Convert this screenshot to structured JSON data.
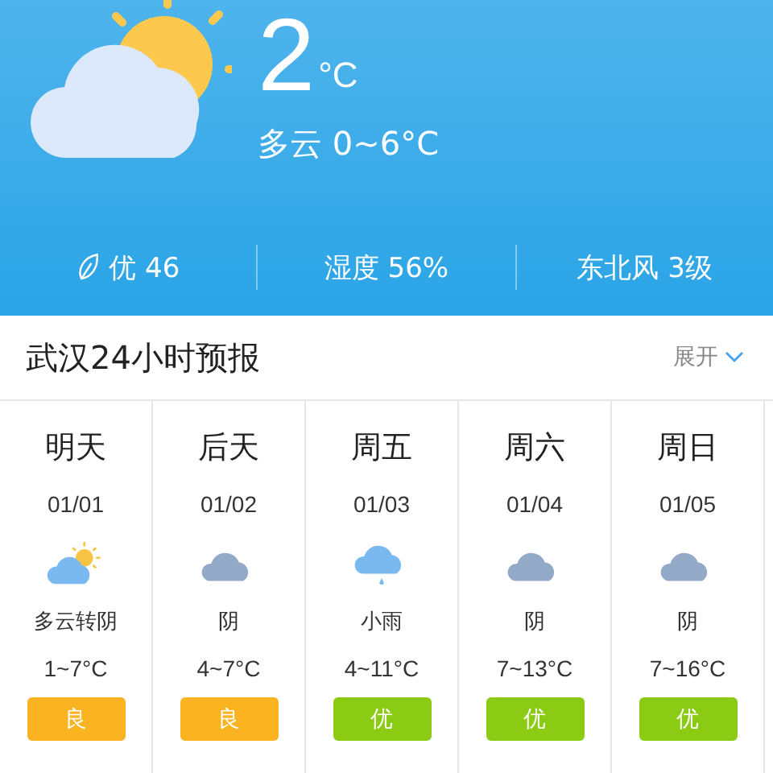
{
  "current": {
    "kind": "partly_cloudy",
    "temperature": "2",
    "unit": "°C",
    "summary": "多云 0~6°C"
  },
  "stats": [
    {
      "kind": "aqi",
      "text": "优 46"
    },
    {
      "kind": "plain",
      "text": "湿度 56%"
    },
    {
      "kind": "plain",
      "text": "东北风 3级"
    }
  ],
  "forecast": {
    "title": "武汉24小时预报",
    "expand_label": "展开",
    "days": [
      {
        "day": "明天",
        "date": "01/01",
        "kind": "partly_cloudy",
        "condition": "多云转阴",
        "temp": "1~7°C",
        "aqi": "良",
        "color": "#fbb321"
      },
      {
        "day": "后天",
        "date": "01/02",
        "kind": "overcast",
        "condition": "阴",
        "temp": "4~7°C",
        "aqi": "良",
        "color": "#fbb321"
      },
      {
        "day": "周五",
        "date": "01/03",
        "kind": "light_rain",
        "condition": "小雨",
        "temp": "4~11°C",
        "aqi": "优",
        "color": "#8bcb13"
      },
      {
        "day": "周六",
        "date": "01/04",
        "kind": "overcast",
        "condition": "阴",
        "temp": "7~13°C",
        "aqi": "优",
        "color": "#8bcb13"
      },
      {
        "day": "周日",
        "date": "01/05",
        "kind": "overcast",
        "condition": "阴",
        "temp": "7~16°C",
        "aqi": "优",
        "color": "#8bcb13"
      }
    ]
  }
}
